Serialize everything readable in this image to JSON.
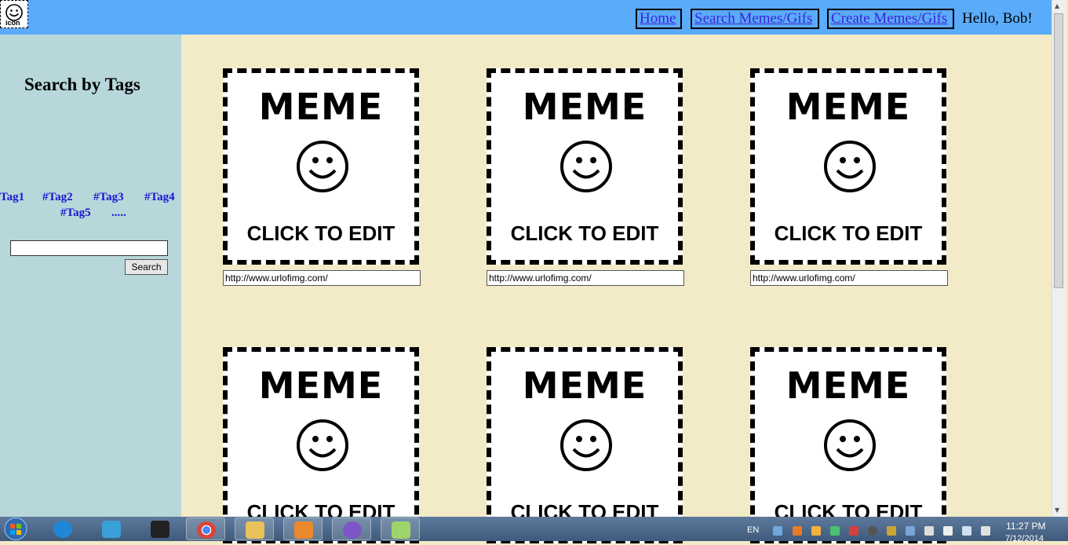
{
  "logo": {
    "text": "icon"
  },
  "nav": {
    "home": "Home ",
    "search": "Search Memes/Gifs",
    "create": "Create Memes/Gifs",
    "greeting": "Hello, Bob!"
  },
  "sidebar": {
    "title": "Search by Tags",
    "tags": [
      "Tag1",
      "#Tag2",
      "#Tag3",
      "#Tag4",
      "#Tag5",
      "....."
    ],
    "search_button": "Search",
    "search_value": ""
  },
  "cards": [
    {
      "title": "MEME",
      "action": "CLICK TO EDIT",
      "url": "http://www.urlofimg.com/"
    },
    {
      "title": "MEME",
      "action": "CLICK TO EDIT",
      "url": "http://www.urlofimg.com/"
    },
    {
      "title": "MEME",
      "action": "CLICK TO EDIT",
      "url": "http://www.urlofimg.com/"
    },
    {
      "title": "MEME",
      "action": "CLICK TO EDIT"
    },
    {
      "title": "MEME",
      "action": "CLICK TO EDIT"
    },
    {
      "title": "MEME",
      "action": "CLICK TO EDIT"
    }
  ],
  "taskbar": {
    "apps": [
      "start-icon",
      "internet-explorer-icon",
      "network-icon",
      "terminal-icon",
      "chrome-icon",
      "file-explorer-icon",
      "media-player-icon",
      "cat-app-icon",
      "notepad-plus-icon"
    ],
    "language": "EN",
    "time": "11:27 PM",
    "date": "7/12/2014"
  },
  "colors": {
    "header": "#5aabfa",
    "sidebar": "#b7d7da",
    "content": "#f3eac7",
    "tag": "#1717d2",
    "link": "#3b24d8"
  }
}
